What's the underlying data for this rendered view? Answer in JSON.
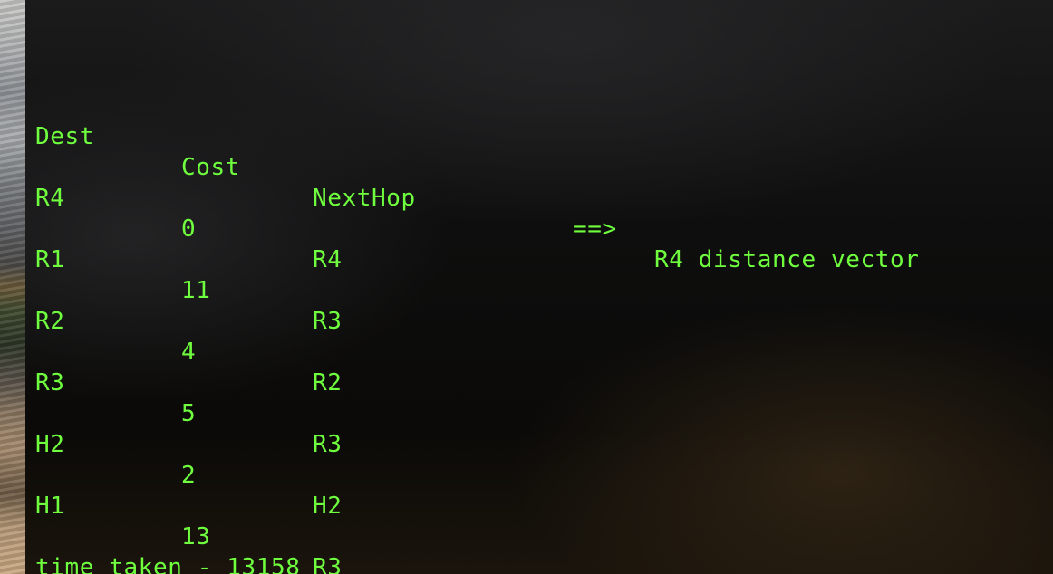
{
  "terminal": {
    "header": {
      "dest": "Dest",
      "cost": "Cost",
      "nexthop": "NextHop",
      "arrow": "==>",
      "title": "R4 distance vector"
    },
    "rows": [
      {
        "dest": "R4",
        "cost": "0",
        "nexthop": "R4"
      },
      {
        "dest": "R1",
        "cost": "11",
        "nexthop": "R3"
      },
      {
        "dest": "R2",
        "cost": "4",
        "nexthop": "R2"
      },
      {
        "dest": "R3",
        "cost": "5",
        "nexthop": "R3"
      },
      {
        "dest": "H2",
        "cost": "2",
        "nexthop": "H2"
      },
      {
        "dest": "H1",
        "cost": "13",
        "nexthop": "R3"
      }
    ],
    "footer": "time taken - 13158",
    "text_color": "#6fff3e"
  }
}
